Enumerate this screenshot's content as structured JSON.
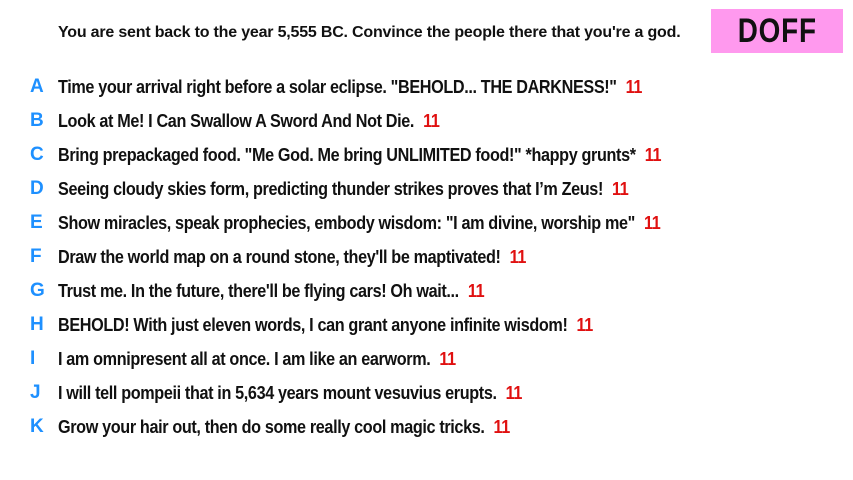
{
  "prompt": "You are sent back to the year 5,555 BC. Convince the people there that you're a god.",
  "badge": {
    "label": "DOFF",
    "color": "#ff99ee"
  },
  "colors": {
    "letter": "#1e90ff",
    "score": "#e01010"
  },
  "answers": [
    {
      "letter": "A",
      "text": "Time your arrival right before a solar eclipse. \"BEHOLD... THE DARKNESS!\"",
      "score": "11"
    },
    {
      "letter": "B",
      "text": "Look at Me! I Can Swallow A Sword And Not Die.",
      "score": "11"
    },
    {
      "letter": "C",
      "text": "Bring prepackaged food. \"Me God. Me bring UNLIMITED food!\" *happy grunts*",
      "score": "11"
    },
    {
      "letter": "D",
      "text": "Seeing cloudy skies form, predicting thunder strikes proves that I’m Zeus!",
      "score": "11"
    },
    {
      "letter": "E",
      "text": "Show miracles, speak prophecies, embody wisdom: \"I am divine, worship me\"",
      "score": "11"
    },
    {
      "letter": "F",
      "text": "Draw the world map on a round stone, they'll be maptivated!",
      "score": "11"
    },
    {
      "letter": "G",
      "text": "Trust me. In the future, there'll be flying cars! Oh wait...",
      "score": "11"
    },
    {
      "letter": "H",
      "text": "BEHOLD! With just eleven words, I can grant anyone infinite wisdom!",
      "score": "11"
    },
    {
      "letter": "I",
      "text": "I am omnipresent all at once. I am like an earworm.",
      "score": "11"
    },
    {
      "letter": "J",
      "text": "I will tell pompeii that in 5,634 years mount vesuvius erupts.",
      "score": "11"
    },
    {
      "letter": "K",
      "text": "Grow your hair out, then do some really cool magic tricks.",
      "score": "11"
    }
  ]
}
